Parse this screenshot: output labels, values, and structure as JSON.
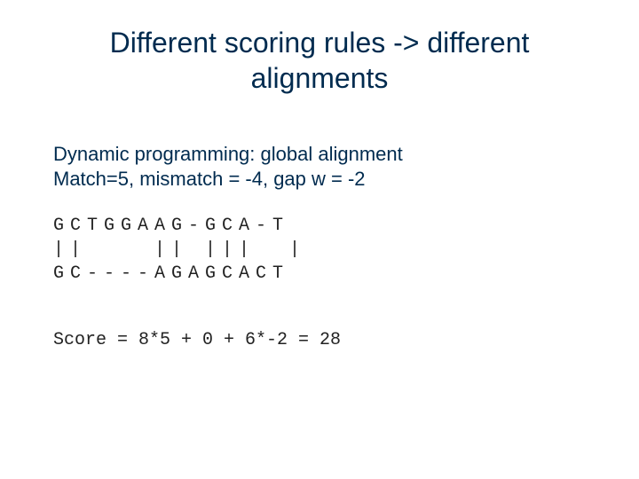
{
  "title": "Different scoring rules -> different alignments",
  "body": {
    "line1": "Dynamic programming: global alignment",
    "line2": "Match=5, mismatch = -4, gap w = -2"
  },
  "alignment": {
    "seq1": "GCTGGAAG-GCA-T",
    "bars": "||    || |||  |",
    "seq2": "GC----AGAGCACT"
  },
  "score_text": "Score = 8*5 + 0 + 6*-2 = 28"
}
